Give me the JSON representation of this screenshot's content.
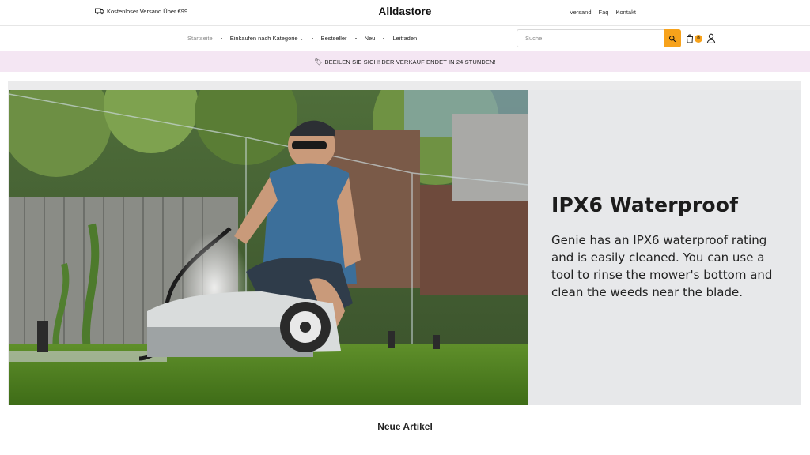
{
  "topbar": {
    "shipping_text": "Kostenloser Versand Über €99",
    "logo": "Alldastore",
    "links": [
      "Versand",
      "Faq",
      "Kontakt"
    ]
  },
  "nav": {
    "items": [
      "Startseite",
      "Einkaufen nach Kategorie",
      "Bestseller",
      "Neu",
      "Leitfaden"
    ],
    "search_placeholder": "Suche",
    "cart_count": "0"
  },
  "promo": {
    "text": "BEEILEN SIE SICH! DER VERKAUF ENDET IN 24 STUNDEN!"
  },
  "hero": {
    "title": "IPX6 Waterproof",
    "text": "Genie has an IPX6 waterproof rating and is easily cleaned. You can use a tool to rinse the mower's bottom and clean the weeds near the blade."
  },
  "section": {
    "title": "Neue Artikel"
  },
  "colors": {
    "accent": "#f7a21b",
    "promo_bg": "#f4e6f3",
    "hero_panel_bg": "#e7e8ea"
  },
  "icons": [
    "truck-icon",
    "search-icon",
    "bag-icon",
    "user-icon",
    "tag-icon",
    "chevron-down-icon"
  ]
}
